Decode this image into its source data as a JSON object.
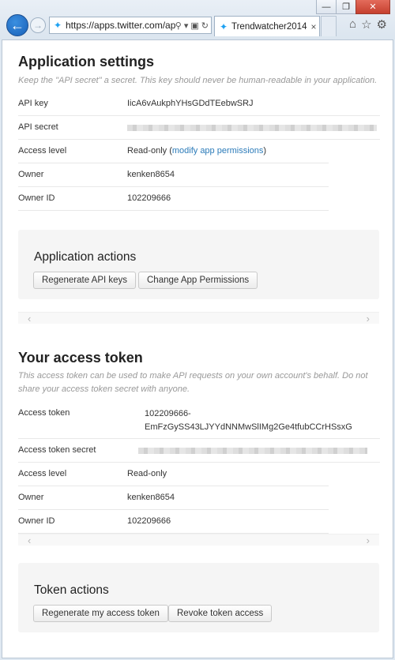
{
  "browser": {
    "window_controls": [
      "—",
      "❐",
      "✕"
    ],
    "url": "https://apps.twitter.com/app",
    "tab_title": "Trendwatcher2014 ...",
    "tab_close": "×"
  },
  "app_settings": {
    "title": "Application settings",
    "note": "Keep the \"API secret\" a secret. This key should never be human-readable in your application.",
    "rows": [
      {
        "key": "API key",
        "value": "IicA6vAukphYHsGDdTEebwSRJ"
      },
      {
        "key": "API secret",
        "value": ""
      },
      {
        "key": "Access level",
        "value": "Read-only (",
        "link": "modify app permissions",
        "after": ")"
      },
      {
        "key": "Owner",
        "value": "kenken8654"
      },
      {
        "key": "Owner ID",
        "value": "102209666"
      }
    ]
  },
  "app_actions": {
    "title": "Application actions",
    "regenerate_label": "Regenerate API keys",
    "change_perm_label": "Change App Permissions"
  },
  "access_token": {
    "title": "Your access token",
    "note": "This access token can be used to make API requests on your own account's behalf. Do not share your access token secret with anyone.",
    "token_key": "Access token",
    "token_line1": "102209666-",
    "token_line2": "EmFzGySS43LJYYdNNMwSlIMg2Ge4tfubCCrHSsxG",
    "secret_key": "Access token secret",
    "rows": [
      {
        "key": "Access level",
        "value": "Read-only"
      },
      {
        "key": "Owner",
        "value": "kenken8654"
      },
      {
        "key": "Owner ID",
        "value": "102209666"
      }
    ]
  },
  "token_actions": {
    "title": "Token actions",
    "regenerate_label": "Regenerate my access token",
    "revoke_label": "Revoke token access"
  },
  "scroll": {
    "left": "‹",
    "right": "›"
  }
}
